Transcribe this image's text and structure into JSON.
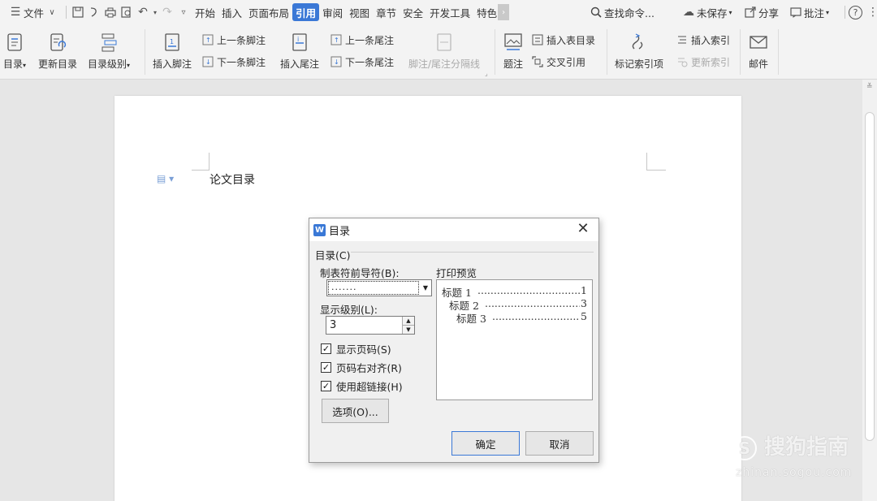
{
  "menubar": {
    "file_label": "文件",
    "tabs": [
      {
        "label": "开始",
        "active": false
      },
      {
        "label": "插入",
        "active": false
      },
      {
        "label": "页面布局",
        "active": false
      },
      {
        "label": "引用",
        "active": true
      },
      {
        "label": "审阅",
        "active": false
      },
      {
        "label": "视图",
        "active": false
      },
      {
        "label": "章节",
        "active": false
      },
      {
        "label": "安全",
        "active": false
      },
      {
        "label": "开发工具",
        "active": false
      },
      {
        "label": "特色",
        "active": false
      }
    ],
    "search_label": "查找命令...",
    "unsaved_label": "未保存",
    "share_label": "分享",
    "comment_label": "批注",
    "help_icon": "help-icon",
    "accent_color": "#3a78d6"
  },
  "ribbon": {
    "toc": "目录",
    "update_toc": "更新目录",
    "toc_level": "目录级别",
    "insert_footnote": "插入脚注",
    "prev_footnote": "上一条脚注",
    "next_footnote": "下一条脚注",
    "insert_endnote": "插入尾注",
    "prev_endnote": "上一条尾注",
    "next_endnote": "下一条尾注",
    "note_separator": "脚注/尾注分隔线",
    "caption": "题注",
    "insert_table_of_figures": "插入表目录",
    "cross_reference": "交叉引用",
    "mark_index_entry": "标记索引项",
    "insert_index": "插入索引",
    "update_index": "更新索引",
    "mail": "邮件"
  },
  "document": {
    "heading_text": "论文目录"
  },
  "dialog": {
    "title": "目录",
    "group_label": "目录(C)",
    "leader_label": "制表符前导符(B):",
    "leader_value": ".......",
    "level_label": "显示级别(L):",
    "level_value": "3",
    "show_page_numbers": {
      "label": "显示页码(S)",
      "checked": true
    },
    "right_align": {
      "label": "页码右对齐(R)",
      "checked": true
    },
    "use_hyperlinks": {
      "label": "使用超链接(H)",
      "checked": true
    },
    "options_button": "选项(O)...",
    "preview_label": "打印预览",
    "preview_entries": [
      {
        "text": "标题 1",
        "page": "1",
        "indent": 0
      },
      {
        "text": "标题 2",
        "page": "3",
        "indent": 1
      },
      {
        "text": "标题 3",
        "page": "5",
        "indent": 2
      }
    ],
    "ok_button": "确定",
    "cancel_button": "取消"
  },
  "watermark": {
    "brand": "搜狗指南",
    "url": "zhinan.sogou.com"
  }
}
